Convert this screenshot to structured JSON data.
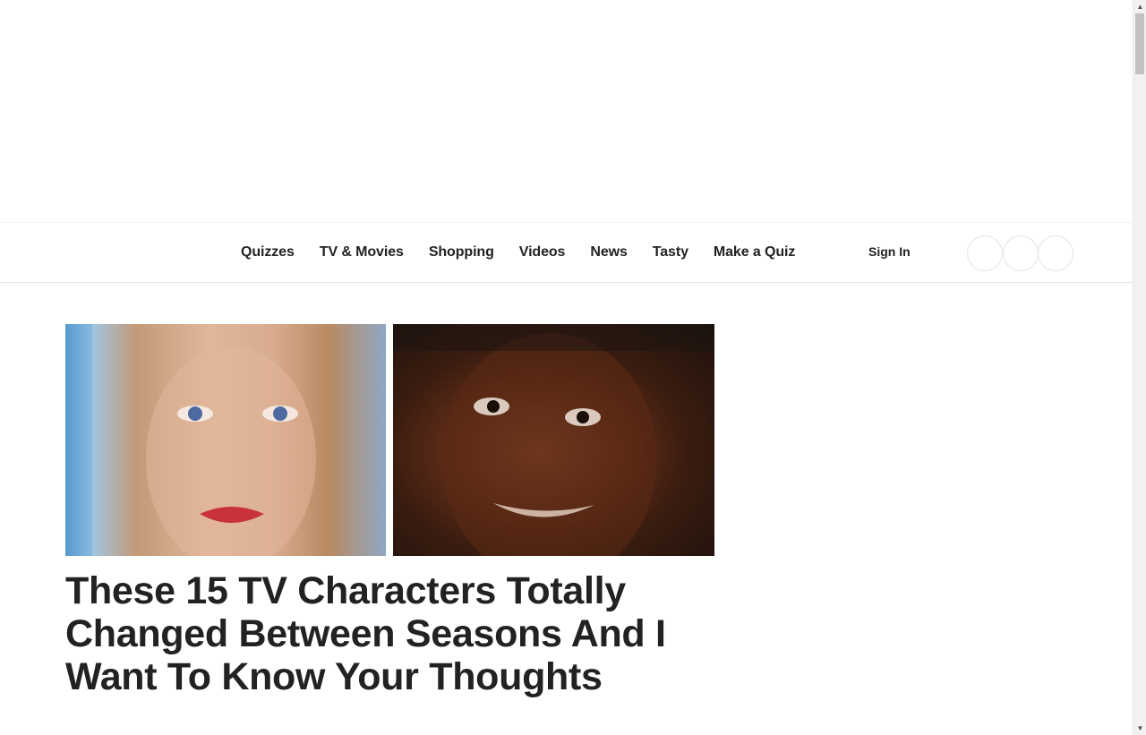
{
  "nav": {
    "links": [
      "Quizzes",
      "TV & Movies",
      "Shopping",
      "Videos",
      "News",
      "Tasty",
      "Make a Quiz"
    ],
    "sign_in_label": "Sign In"
  },
  "article": {
    "headline": "These 15 TV Characters Totally Changed Between Seasons And I Want To Know Your Thoughts"
  },
  "colors": {
    "text": "#222222",
    "background": "#ffffff",
    "nav_border": "#e6e6e6"
  },
  "icons": {
    "up_arrow": "▲",
    "down_arrow": "▼"
  }
}
